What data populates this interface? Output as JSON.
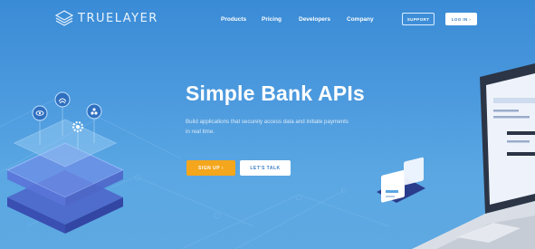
{
  "brand": {
    "name": "TRUELAYER",
    "logo_icon": "layers-logo-icon"
  },
  "nav": {
    "links": [
      "Products",
      "Pricing",
      "Developers",
      "Company"
    ],
    "support_label": "SUPPORT",
    "login_label": "LOG IN ›"
  },
  "hero": {
    "title": "Simple Bank APIs",
    "subtitle": "Build applications that securely access data and initiate payments in real time.",
    "signup_label": "SIGN UP ›",
    "talk_label": "LET'S TALK"
  },
  "colors": {
    "background_top": "#3a8bd6",
    "background_bottom": "#5fa9e2",
    "accent_orange": "#f4a61c",
    "button_text_blue": "#3b7fc4"
  },
  "illustration_icons": [
    "eye-icon",
    "fingerprint-icon",
    "gear-icon",
    "recycle-icon"
  ]
}
